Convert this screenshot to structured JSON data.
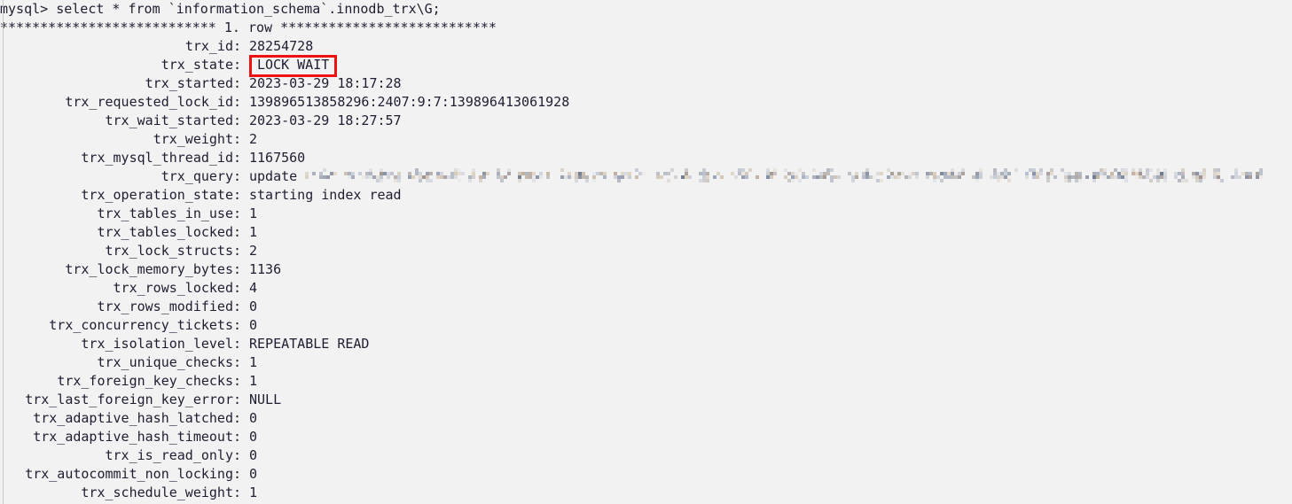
{
  "terminal": {
    "background_color": "#f2f2f2",
    "text_color": "#1e1e32",
    "highlight_color": "#ee1111",
    "prompt_line": "mysql> select * from `information_schema`.innodb_trx\\G;",
    "row_separator": "*************************** 1. row ***************************",
    "separator_star_count_left": 27,
    "separator_star_count_right": 27,
    "row_label": "1. row",
    "colon": ":",
    "fields": [
      {
        "label": "trx_id",
        "value": "28254728",
        "highlighted": false,
        "redacted": false
      },
      {
        "label": "trx_state",
        "value": "LOCK WAIT",
        "highlighted": true,
        "redacted": false
      },
      {
        "label": "trx_started",
        "value": "2023-03-29 18:17:28",
        "highlighted": false,
        "redacted": false
      },
      {
        "label": "trx_requested_lock_id",
        "value": "139896513858296:2407:9:7:139896413061928",
        "highlighted": false,
        "redacted": false
      },
      {
        "label": "trx_wait_started",
        "value": "2023-03-29 18:27:57",
        "highlighted": false,
        "redacted": false
      },
      {
        "label": "trx_weight",
        "value": "2",
        "highlighted": false,
        "redacted": false
      },
      {
        "label": "trx_mysql_thread_id",
        "value": "1167560",
        "highlighted": false,
        "redacted": false
      },
      {
        "label": "trx_query",
        "value": "update ",
        "highlighted": false,
        "redacted": true,
        "redacted_width": 1080
      },
      {
        "label": "trx_operation_state",
        "value": "starting index read",
        "highlighted": false,
        "redacted": false
      },
      {
        "label": "trx_tables_in_use",
        "value": "1",
        "highlighted": false,
        "redacted": false
      },
      {
        "label": "trx_tables_locked",
        "value": "1",
        "highlighted": false,
        "redacted": false
      },
      {
        "label": "trx_lock_structs",
        "value": "2",
        "highlighted": false,
        "redacted": false
      },
      {
        "label": "trx_lock_memory_bytes",
        "value": "1136",
        "highlighted": false,
        "redacted": false
      },
      {
        "label": "trx_rows_locked",
        "value": "4",
        "highlighted": false,
        "redacted": false
      },
      {
        "label": "trx_rows_modified",
        "value": "0",
        "highlighted": false,
        "redacted": false
      },
      {
        "label": "trx_concurrency_tickets",
        "value": "0",
        "highlighted": false,
        "redacted": false
      },
      {
        "label": "trx_isolation_level",
        "value": "REPEATABLE READ",
        "highlighted": false,
        "redacted": false
      },
      {
        "label": "trx_unique_checks",
        "value": "1",
        "highlighted": false,
        "redacted": false
      },
      {
        "label": "trx_foreign_key_checks",
        "value": "1",
        "highlighted": false,
        "redacted": false
      },
      {
        "label": "trx_last_foreign_key_error",
        "value": "NULL",
        "highlighted": false,
        "redacted": false
      },
      {
        "label": "trx_adaptive_hash_latched",
        "value": "0",
        "highlighted": false,
        "redacted": false
      },
      {
        "label": "trx_adaptive_hash_timeout",
        "value": "0",
        "highlighted": false,
        "redacted": false
      },
      {
        "label": "trx_is_read_only",
        "value": "0",
        "highlighted": false,
        "redacted": false
      },
      {
        "label": "trx_autocommit_non_locking",
        "value": "0",
        "highlighted": false,
        "redacted": false
      },
      {
        "label": "trx_schedule_weight",
        "value": "1",
        "highlighted": false,
        "redacted": false
      }
    ]
  }
}
